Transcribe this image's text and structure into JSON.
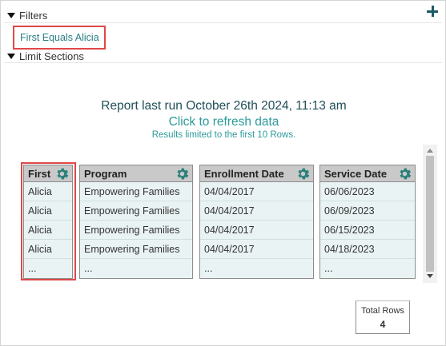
{
  "filters": {
    "title": "Filters",
    "active_filter": "First Equals Alicia"
  },
  "limit_sections": {
    "title": "Limit Sections"
  },
  "report": {
    "last_run": "Report last run October 26th 2024, 11:13 am",
    "refresh_link": "Click to refresh data",
    "limit_note": "Results limited to the first 10 Rows."
  },
  "tables": {
    "first": {
      "header": "First",
      "rows": [
        "Alicia",
        "Alicia",
        "Alicia",
        "Alicia",
        "..."
      ]
    },
    "program": {
      "header": "Program",
      "rows": [
        "Empowering Families",
        "Empowering Families",
        "Empowering Families",
        "Empowering Families",
        "..."
      ]
    },
    "enrollment_date": {
      "header": "Enrollment Date",
      "rows": [
        "04/04/2017",
        "04/04/2017",
        "04/04/2017",
        "04/04/2017",
        "..."
      ]
    },
    "service_date": {
      "header": "Service Date",
      "rows": [
        "06/06/2023",
        "06/09/2023",
        "06/15/2023",
        "04/18/2023",
        "..."
      ]
    }
  },
  "totals": {
    "label": "Total Rows",
    "value": "4"
  },
  "colors": {
    "accent_teal": "#2c9b9a",
    "gear_teal": "#2a7f7a",
    "highlight_red": "#e04848",
    "header_gray": "#c9c9c9",
    "cell_bg": "#eaf3f4"
  },
  "icons": {
    "add": "plus-icon",
    "collapse": "triangle-down-icon",
    "column_settings": "gear-icon"
  }
}
